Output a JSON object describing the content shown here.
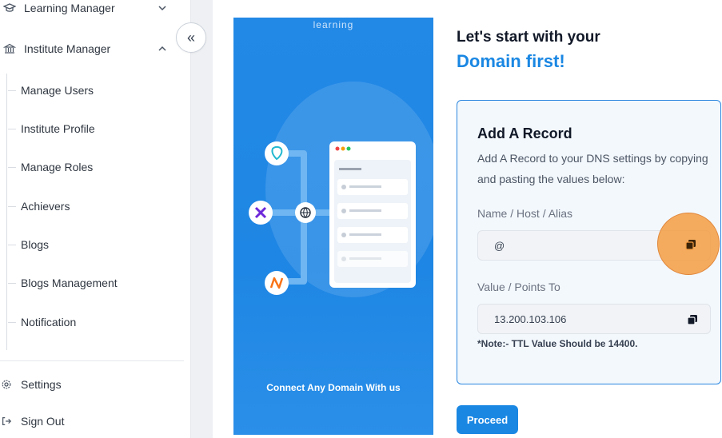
{
  "sidebar": {
    "learning_manager": "Learning Manager",
    "institute_manager": "Institute Manager",
    "sub_items": [
      {
        "label": "Manage Users"
      },
      {
        "label": "Institute Profile"
      },
      {
        "label": "Manage Roles"
      },
      {
        "label": "Achievers"
      },
      {
        "label": "Blogs"
      },
      {
        "label": "Blogs Management"
      },
      {
        "label": "Notification"
      }
    ],
    "settings": "Settings",
    "sign_out": "Sign Out",
    "collapse_glyph": "«"
  },
  "hero": {
    "brand": "learning",
    "caption": "Connect Any Domain With us"
  },
  "main": {
    "headline_line1": "Let's start with your",
    "headline_line2": "Domain first!",
    "record": {
      "title": "Add A Record",
      "description": "Add A Record to your DNS settings by copying and pasting the values below:",
      "name_label": "Name / Host / Alias",
      "name_value": "@",
      "value_label": "Value / Points To",
      "value_value": "13.200.103.106",
      "note": "*Note:- TTL Value Should be 14400."
    },
    "proceed_label": "Proceed"
  },
  "colors": {
    "accent": "#1a87e3",
    "hero_bg": "#2389e6",
    "highlight": "#f59e42"
  }
}
